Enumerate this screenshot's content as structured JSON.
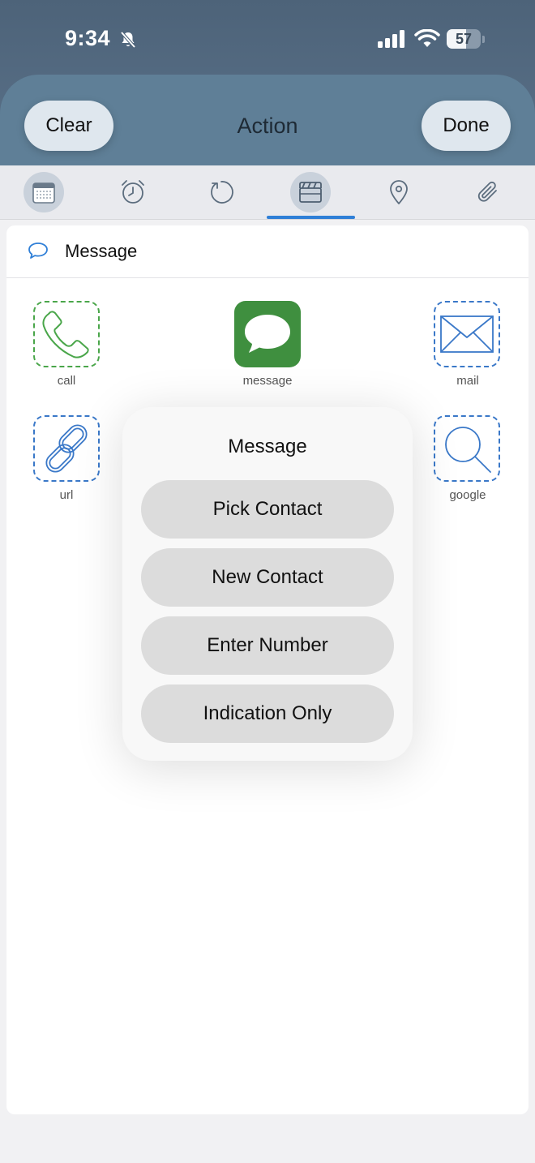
{
  "status_bar": {
    "time": "9:34",
    "battery": "57",
    "battery_level_percent": 57,
    "silent_icon": "bell-slash-icon",
    "signal_icon": "cellular-signal-icon",
    "wifi_icon": "wifi-icon"
  },
  "header": {
    "title": "Action",
    "clear_label": "Clear",
    "done_label": "Done"
  },
  "tabs": [
    {
      "icon": "calendar-icon",
      "selected": true
    },
    {
      "icon": "alarm-clock-icon",
      "selected": false
    },
    {
      "icon": "repeat-icon",
      "selected": false
    },
    {
      "icon": "clapperboard-icon",
      "selected": true,
      "active": true
    },
    {
      "icon": "location-pin-icon",
      "selected": false
    },
    {
      "icon": "paperclip-icon",
      "selected": false
    }
  ],
  "section": {
    "icon": "speech-bubble-icon",
    "label": "Message"
  },
  "actions": {
    "call": "call",
    "message": "message",
    "mail": "mail",
    "url": "url",
    "google": "google"
  },
  "popover": {
    "title": "Message",
    "buttons": [
      "Pick Contact",
      "New Contact",
      "Enter Number",
      "Indication Only"
    ]
  },
  "colors": {
    "header_bg": "#5f7f97",
    "accent_blue": "#2f7fd7",
    "call_green": "#4aa64a",
    "message_green": "#3f8f3f",
    "tile_blue": "#3a78c8"
  }
}
